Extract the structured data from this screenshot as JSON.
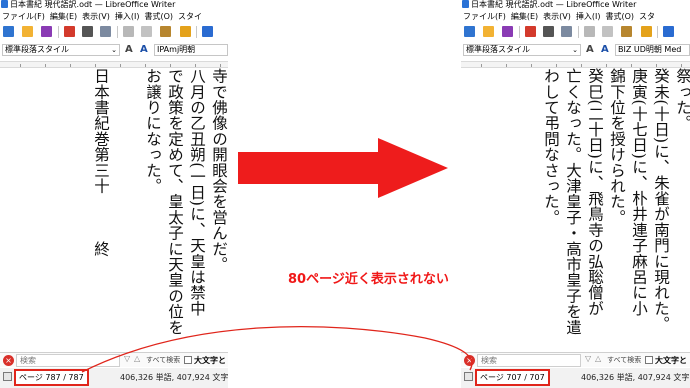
{
  "left": {
    "title": "日本書紀 現代語訳.odt — LibreOffice Writer",
    "menu": [
      "ファイル(F)",
      "編集(E)",
      "表示(V)",
      "挿入(I)",
      "書式(O)",
      "スタイ"
    ],
    "paragraph_style": "標準段落スタイル",
    "font_name": "IPAmj明朝",
    "columns": [
      "寺で佛像の開眼会を営んだ。",
      "八月の乙丑朔(一日)に、天皇は禁中",
      "で政策を定めて、皇太子に天皇の位を",
      "お譲りになった。",
      "",
      "日本書紀巻第三十　　　終"
    ],
    "search_placeholder": "検索",
    "find_all": "すべて検索",
    "match_case": "大文字と",
    "page_status": "ページ 787 / 787",
    "word_count": "406,326 単語, 407,924 文字"
  },
  "right": {
    "title": "日本書紀 現代語訳.odt — LibreOffice Writer",
    "menu": [
      "ファイル(F)",
      "編集(E)",
      "表示(V)",
      "挿入(I)",
      "書式(O)",
      "スタ"
    ],
    "paragraph_style": "標準段落スタイル",
    "font_name": "BIZ UD明朝 Med",
    "columns": [
      "祭った。",
      "癸未(十日)に、朱雀が南門に現れた。",
      "庚寅(十七日)に、朴井連子麻呂に小",
      "錦下位を授けられた。",
      "癸巳(二十日)に、飛鳥寺の弘聡僧が",
      "亡くなった。大津皇子・高市皇子を遣",
      "わして弔問なさった。"
    ],
    "search_placeholder": "検索",
    "find_all": "すべて検索",
    "match_case": "大文字と",
    "page_status": "ページ 707 / 707",
    "word_count": "406,326 単語, 407,924 文字"
  },
  "annotation": "80ページ近く表示されない",
  "colors": {
    "annotation_red": "#f01818",
    "arrow_red": "#ee1c1c",
    "highlight_box": "#e0251b"
  },
  "icons": [
    "new-document-icon",
    "open-folder-icon",
    "save-icon",
    "export-pdf-icon",
    "print-icon",
    "print-preview-icon",
    "cut-icon",
    "copy-icon",
    "paste-icon",
    "clone-formatting-icon",
    "undo-icon"
  ]
}
